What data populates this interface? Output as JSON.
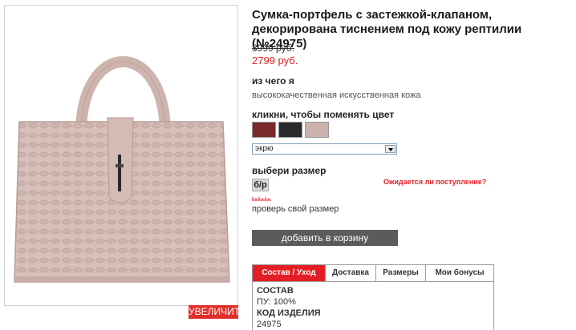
{
  "product": {
    "title": "Сумка-портфель с застежкой-клапаном, декорирована тиснением под кожу рептилии (№24975)",
    "old_price": "3999 руб.",
    "new_price": "2799 руб.",
    "zoom_label": "УВЕЛИЧИТЬ"
  },
  "material": {
    "label": "из чего я",
    "value": "высококачественная искусственная кожа"
  },
  "color": {
    "label": "кликни, чтобы поменять цвет",
    "swatches": [
      {
        "name": "бордо",
        "color": "#7a2a2a"
      },
      {
        "name": "черный",
        "color": "#2a2a2a"
      },
      {
        "name": "экрю",
        "color": "#cbb2ad"
      }
    ],
    "selected": "экрю"
  },
  "size": {
    "label": "выбери размер",
    "value": "б/р",
    "expected_link": "Ожидается ли поступление?",
    "check_link": "проверь свой размер"
  },
  "cart": {
    "add_label": "добавить в корзину"
  },
  "tabs": {
    "items": [
      "Состав / Уход",
      "Доставка",
      "Размеры",
      "Мои бонусы"
    ],
    "active": 0
  },
  "composition": {
    "heading": "СОСТАВ",
    "value": "ПУ: 100%",
    "code_heading": "КОД ИЗДЕЛИЯ",
    "code_value": "24975"
  },
  "colors": {
    "accent": "#e31e24",
    "button_dark": "#5b5b5b",
    "bag": "#d9c3bd"
  }
}
